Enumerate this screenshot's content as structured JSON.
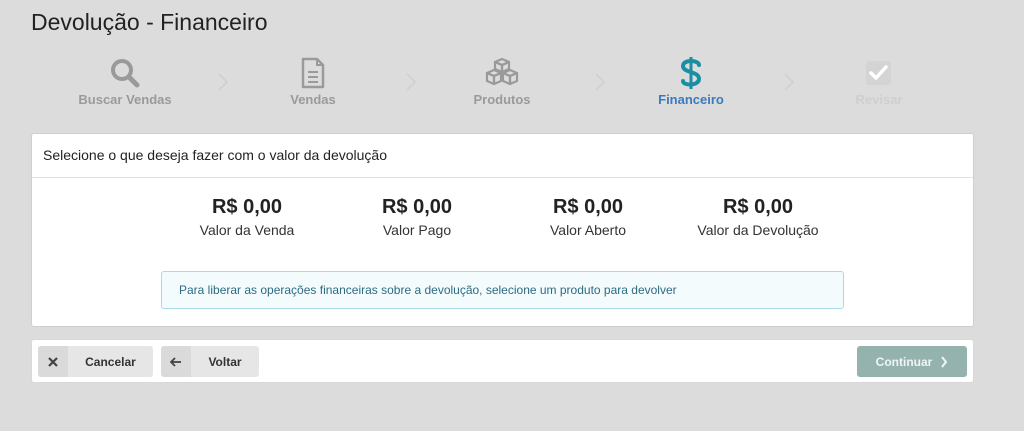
{
  "page": {
    "title": "Devolução - Financeiro"
  },
  "steps": [
    {
      "label": "Buscar Vendas",
      "icon": "search-icon",
      "state": "done"
    },
    {
      "label": "Vendas",
      "icon": "document-icon",
      "state": "done"
    },
    {
      "label": "Produtos",
      "icon": "boxes-icon",
      "state": "done"
    },
    {
      "label": "Financeiro",
      "icon": "dollar-icon",
      "state": "active"
    },
    {
      "label": "Revisar",
      "icon": "checkbox-icon",
      "state": "disabled"
    }
  ],
  "panel": {
    "header": "Selecione o que deseja fazer com o valor da devolução",
    "stats": [
      {
        "value": "R$ 0,00",
        "label": "Valor da Venda"
      },
      {
        "value": "R$ 0,00",
        "label": "Valor Pago"
      },
      {
        "value": "R$ 0,00",
        "label": "Valor Aberto"
      },
      {
        "value": "R$ 0,00",
        "label": "Valor da Devolução"
      }
    ],
    "alert": "Para liberar as operações financeiras sobre a devolução, selecione um produto para devolver"
  },
  "footer": {
    "cancel_label": "Cancelar",
    "back_label": "Voltar",
    "continue_label": "Continuar"
  },
  "colors": {
    "active_step": "#1a8fa3",
    "active_label": "#3a7bbf",
    "continue_button": "#95b3ae"
  }
}
